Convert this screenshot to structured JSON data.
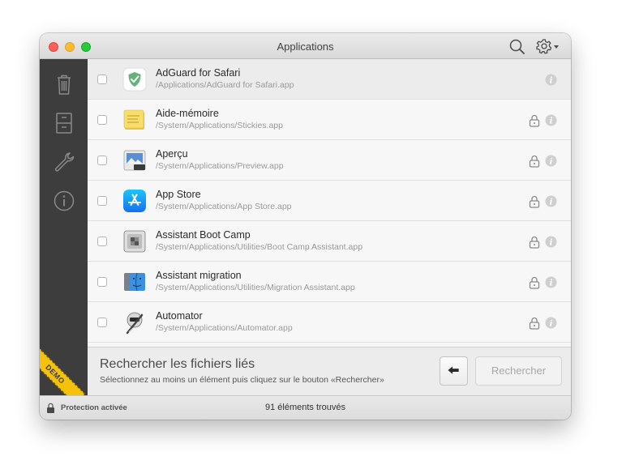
{
  "window": {
    "title": "Applications"
  },
  "toolbar": {
    "search_icon": "search-icon",
    "settings_icon": "gear-icon"
  },
  "sidebar": {
    "items": [
      {
        "name": "trash",
        "icon": "trash-icon"
      },
      {
        "name": "archive",
        "icon": "file-cabinet-icon"
      },
      {
        "name": "tools",
        "icon": "wrench-icon"
      },
      {
        "name": "info",
        "icon": "info-icon"
      }
    ],
    "badge": "DEMO"
  },
  "apps": [
    {
      "name": "AdGuard for Safari",
      "path": "/Applications/AdGuard for Safari.app",
      "locked": false
    },
    {
      "name": "Aide-mémoire",
      "path": "/System/Applications/Stickies.app",
      "locked": true
    },
    {
      "name": "Aperçu",
      "path": "/System/Applications/Preview.app",
      "locked": true
    },
    {
      "name": "App Store",
      "path": "/System/Applications/App Store.app",
      "locked": true
    },
    {
      "name": "Assistant Boot Camp",
      "path": "/System/Applications/Utilities/Boot Camp Assistant.app",
      "locked": true
    },
    {
      "name": "Assistant migration",
      "path": "/System/Applications/Utilities/Migration Assistant.app",
      "locked": true
    },
    {
      "name": "Automator",
      "path": "/System/Applications/Automator.app",
      "locked": true
    }
  ],
  "search_panel": {
    "title": "Rechercher les fichiers liés",
    "subtitle": "Sélectionnez au moins un élément puis cliquez sur le bouton «Rechercher»",
    "button_label": "Rechercher"
  },
  "status": {
    "protection": "Protection activée",
    "count": "91 éléments trouvés"
  },
  "colors": {
    "sidebar": "#3d3d3d",
    "demo_ribbon": "#f4c20d"
  }
}
